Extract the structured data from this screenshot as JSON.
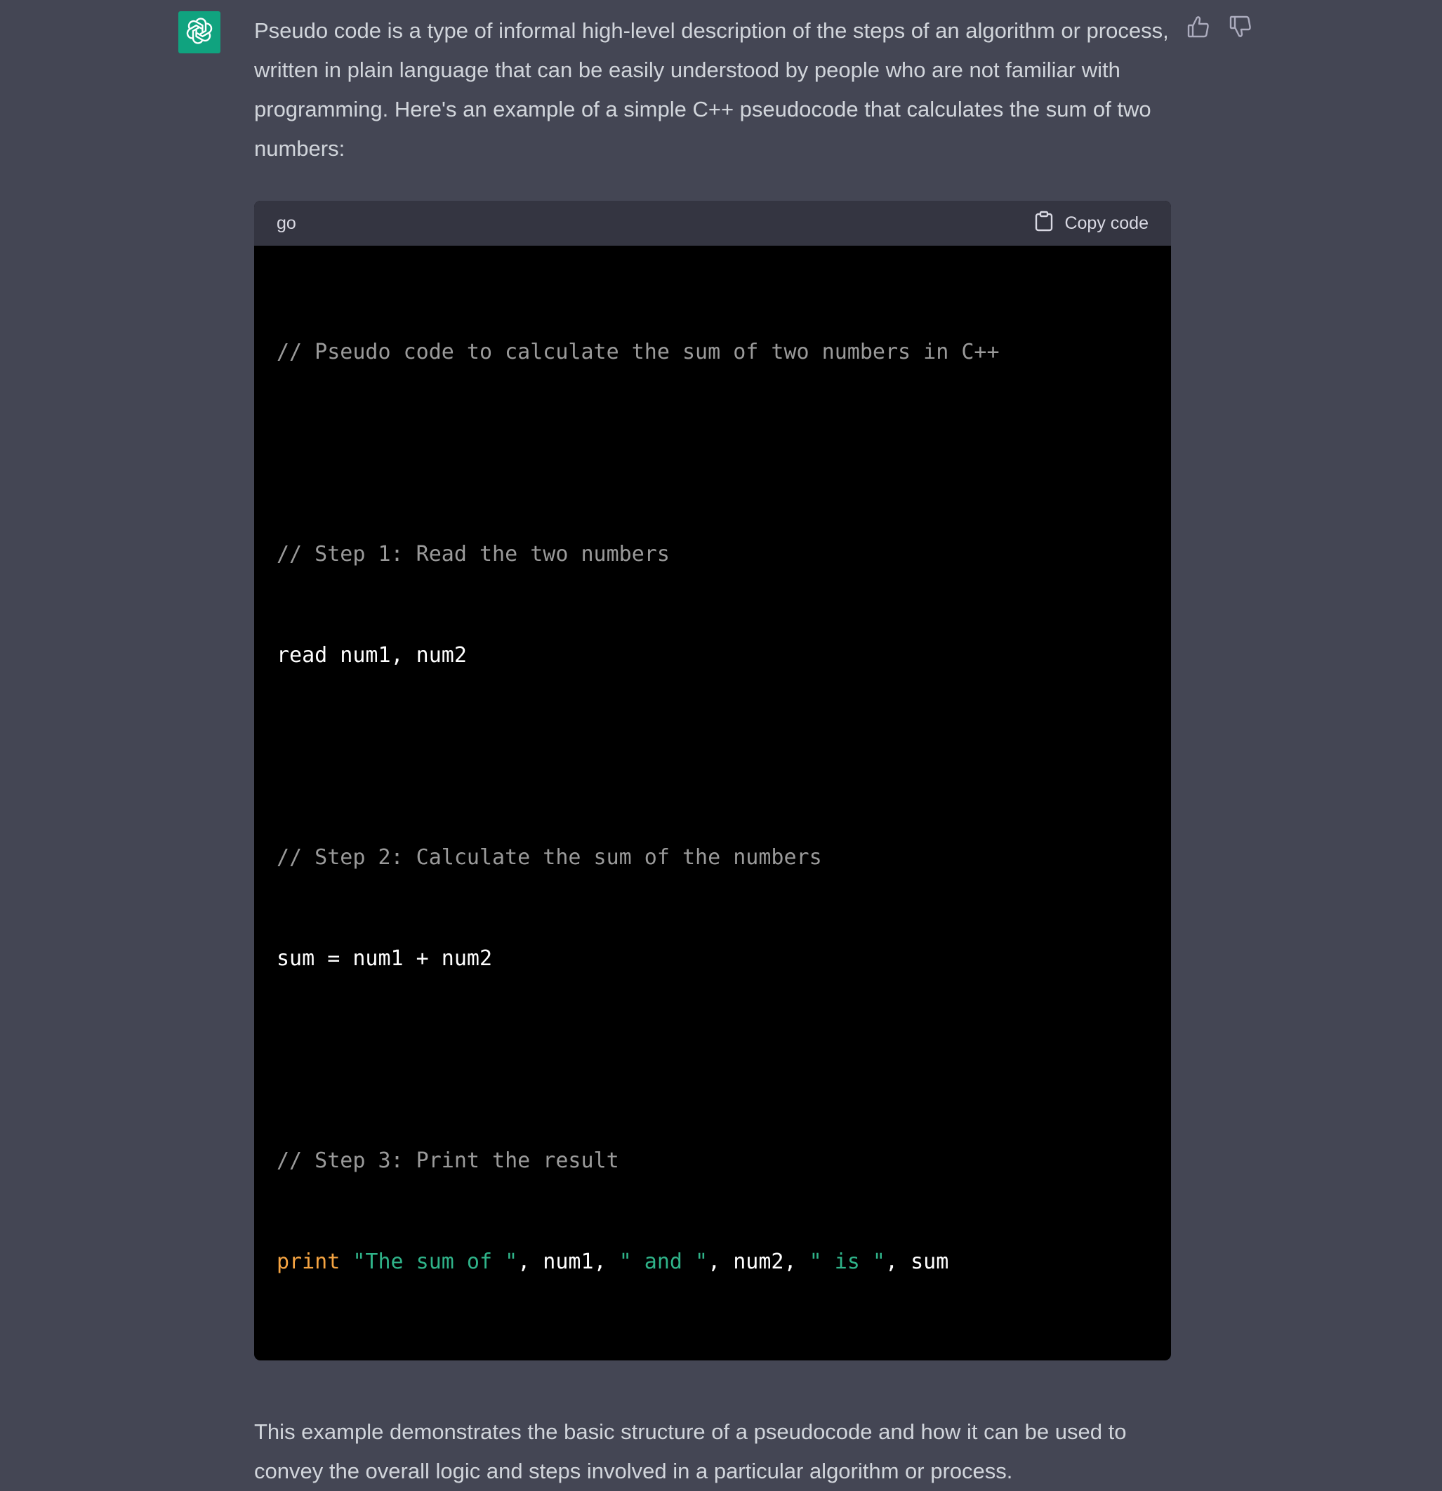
{
  "message": {
    "intro": "Pseudo code is a type of informal high-level description of the steps of an algorithm or process, written in plain language that can be easily understood by people who are not familiar with programming. Here's an example of a simple C++ pseudocode that calculates the sum of two numbers:",
    "outro": "This example demonstrates the basic structure of a pseudocode and how it can be used to convey the overall logic and steps involved in a particular algorithm or process."
  },
  "codeblock": {
    "language": "go",
    "copy_label": "Copy code",
    "line1": "// Pseudo code to calculate the sum of two numbers in C++",
    "line3": "// Step 1: Read the two numbers",
    "line4": "read num1, num2",
    "line6": "// Step 2: Calculate the sum of the numbers",
    "line7": "sum = num1 + num2",
    "line9": "// Step 3: Print the result",
    "line10": {
      "kw": "print",
      "s1": "\"The sum of \"",
      "t1": ", num1, ",
      "s2": "\" and \"",
      "t2": ", num2, ",
      "s3": "\" is \"",
      "t3": ", sum"
    }
  },
  "icons": {
    "avatar": "openai-logo-icon",
    "copy": "clipboard-icon",
    "thumbs_up": "thumbs-up-icon",
    "thumbs_down": "thumbs-down-icon"
  },
  "colors": {
    "background": "#444654",
    "avatar_bg": "#10a37f",
    "code_bg": "#000000",
    "code_header_bg": "#343541",
    "comment": "#9a9a9a",
    "keyword": "#f5a442",
    "string": "#2fb389"
  }
}
